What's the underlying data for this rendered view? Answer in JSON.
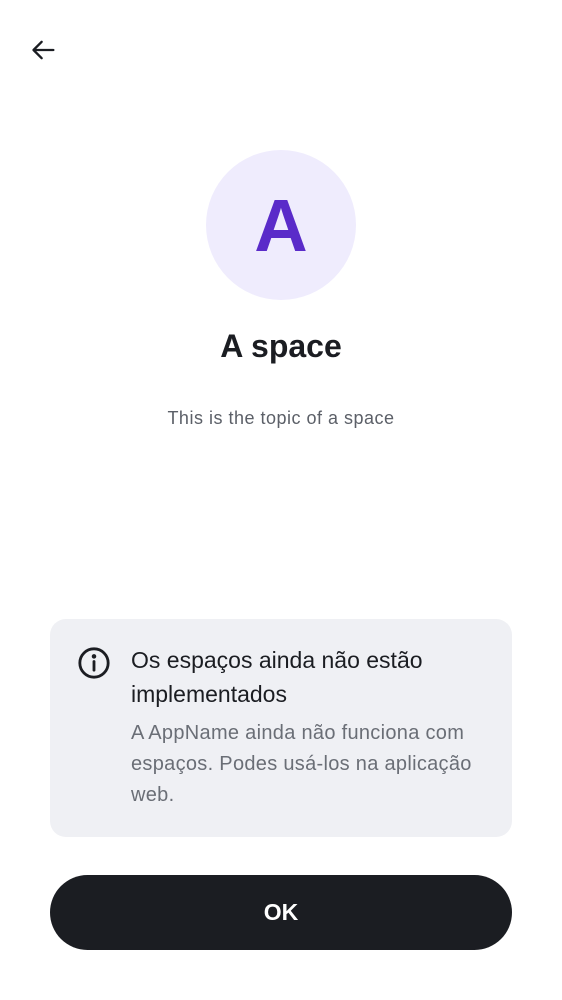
{
  "header": {
    "back_icon": "arrow-left-icon"
  },
  "space": {
    "avatar_letter": "A",
    "name": "A space",
    "topic": "This is the topic of a space"
  },
  "notice": {
    "icon": "info-icon",
    "title": "Os espaços ainda não estão implementados",
    "body": "A AppName ainda não funciona com espaços. Podes usá-los na aplicação web."
  },
  "actions": {
    "ok_label": "OK"
  },
  "colors": {
    "avatar_background": "#efecfd",
    "avatar_letter": "#5a2bc9",
    "card_background": "#eff0f4",
    "primary_button": "#1b1d22",
    "text_primary": "#1b1d22",
    "text_secondary": "#6a6e76"
  }
}
